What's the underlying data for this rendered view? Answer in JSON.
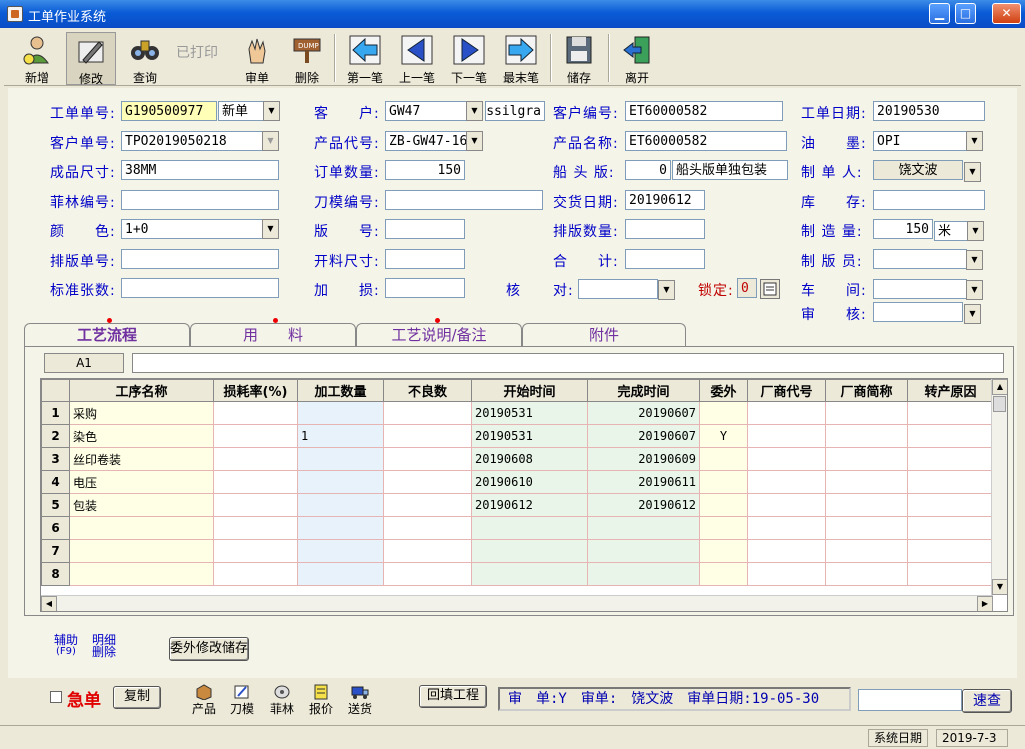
{
  "window": {
    "title": "工单作业系统"
  },
  "toolbar": {
    "new": "新增",
    "edit": "修改",
    "query": "查询",
    "printed": "已打印",
    "audit": "审单",
    "delete": "删除",
    "first": "第一笔",
    "prev": "上一笔",
    "next": "下一笔",
    "last": "最末笔",
    "save": "储存",
    "exit": "离开"
  },
  "form": {
    "order_no_label": "工单单号:",
    "order_no": "G190500977",
    "order_type": "新单",
    "customer_label": "客　　户:",
    "customer": "GW47",
    "customer_name": "essilgra",
    "customer_code_label": "客户编号:",
    "customer_code": "ET60000582",
    "order_date_label": "工单日期:",
    "order_date": "20190530",
    "cust_order_label": "客户单号:",
    "cust_order": "TPO2019050218",
    "product_code_label": "产品代号:",
    "product_code": "ZB-GW47-16",
    "product_name_label": "产品名称:",
    "product_name": "ET60000582",
    "ink_label": "油　　墨:",
    "ink": "OPI",
    "size_label": "成品尺寸:",
    "size": "38MM",
    "qty_label": "订单数量:",
    "qty": "150",
    "plate_label": "船 头 版:",
    "plate_no": "0",
    "plate_text": "船头版单独包装",
    "maker_label": "制 单 人:",
    "maker": "饶文波",
    "film_label": "菲林编号:",
    "film": "",
    "die_label": "刀模编号:",
    "die": "",
    "delivery_label": "交货日期:",
    "delivery": "20190612",
    "stock_label": "库　　存:",
    "stock": "",
    "color_label": "颜　　色:",
    "color": "1+0",
    "plate_num_label": "版　　号:",
    "plate_num": "",
    "layout_qty_label": "排版数量:",
    "layout_qty": "",
    "make_qty_label": "制 造 量:",
    "make_qty": "150",
    "make_unit": "米",
    "layout_order_label": "排版单号:",
    "layout_order": "",
    "cut_size_label": "开料尺寸:",
    "cut_size": "",
    "total_label": "合　　计:",
    "total": "",
    "plater_label": "制 版 员:",
    "plater": "",
    "std_sheets_label": "标准张数:",
    "std_sheets": "",
    "loss_label": "加　　损:",
    "loss": "",
    "check_label_a": "核",
    "check_label_b": "对:",
    "check": "",
    "lock_label": "锁定:",
    "lock": "0",
    "workshop_label": "车　　间:",
    "workshop": "",
    "auditor_label": "审　　核:",
    "auditor": ""
  },
  "tabs": [
    "工艺流程",
    "用　　料",
    "工艺说明/备注",
    "附件"
  ],
  "grid": {
    "cell_ref": "A1",
    "headers": [
      "工序名称",
      "损耗率(%)",
      "加工数量",
      "不良数",
      "开始时间",
      "完成时间",
      "委外",
      "厂商代号",
      "厂商简称",
      "转产原因"
    ],
    "rows": [
      [
        "1",
        "采购",
        "",
        "",
        "",
        "20190531",
        "20190607",
        "",
        "",
        "",
        ""
      ],
      [
        "2",
        "染色",
        "",
        "1",
        "",
        "20190531",
        "20190607",
        "Y",
        "",
        "",
        ""
      ],
      [
        "3",
        "丝印卷装",
        "",
        "",
        "",
        "20190608",
        "20190609",
        "",
        "",
        "",
        ""
      ],
      [
        "4",
        "电压",
        "",
        "",
        "",
        "20190610",
        "20190611",
        "",
        "",
        "",
        ""
      ],
      [
        "5",
        "包装",
        "",
        "",
        "",
        "20190612",
        "20190612",
        "",
        "",
        "",
        ""
      ],
      [
        "6",
        "",
        "",
        "",
        "",
        "",
        "",
        "",
        "",
        "",
        ""
      ],
      [
        "7",
        "",
        "",
        "",
        "",
        "",
        "",
        "",
        "",
        "",
        ""
      ],
      [
        "8",
        "",
        "",
        "",
        "",
        "",
        "",
        "",
        "",
        "",
        ""
      ]
    ]
  },
  "bottom": {
    "assist_line1": "辅助",
    "assist_line2": "(F9)",
    "detail_line1": "明细",
    "detail_line2": "删除",
    "outsource_save": "委外修改储存",
    "urgent": "急单",
    "copy": "复制",
    "product": "产品",
    "die": "刀模",
    "film": "菲林",
    "quote": "报价",
    "deliver": "送货",
    "backfill": "回填工程",
    "audit_info": "审　单:Y　审单:　饶文波　审单日期:19-05-30",
    "audit_flag": "Y",
    "search": "速查",
    "search_value": ""
  },
  "status": {
    "sys_date_label": "系统日期",
    "sys_date": "2019-7-3"
  }
}
